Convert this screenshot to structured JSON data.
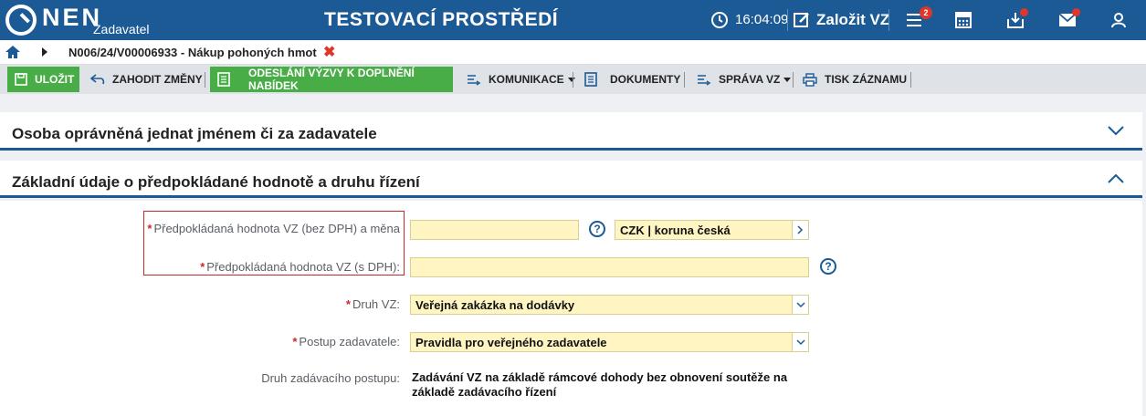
{
  "header": {
    "logo_text": "NEN",
    "logo_sub": "Zadavatel",
    "env_title": "TESTOVACÍ PROSTŘEDÍ",
    "time": "16:04:09",
    "create_label": "Založit VZ",
    "tasks_badge": "2",
    "icons": [
      "clock-icon",
      "edit-icon",
      "tasks-icon",
      "calculator-icon",
      "inbox-icon",
      "mail-icon",
      "user-icon"
    ],
    "brand_color": "#1c5a96"
  },
  "breadcrumb": {
    "text": "N006/24/V00006933 - Nákup pohoných hmot",
    "close": "✖"
  },
  "toolbar": {
    "save": "ULOŽIT",
    "discard": "ZAHODIT ZMĚNY",
    "send": "ODESLÁNÍ VÝZVY K DOPLNĚNÍ NABÍDEK",
    "communication": "KOMUNIKACE",
    "documents": "DOKUMENTY",
    "management": "SPRÁVA VZ",
    "print": "TISK ZÁZNAMU",
    "accent_green": "#49ad47"
  },
  "panels": {
    "authorized_person": "Osoba oprávněná jednat jménem či za zadavatele",
    "basic_info": "Základní údaje o předpokládané hodnotě a druhu řízení"
  },
  "form": {
    "value_excl_vat_label": "Předpokládaná hodnota VZ (bez DPH) a měna",
    "value_excl_vat": "",
    "currency": "CZK | koruna česká",
    "value_incl_vat_label": "Předpokládaná hodnota VZ (s DPH):",
    "value_incl_vat": "",
    "contract_type_label": "Druh VZ:",
    "contract_type": "Veřejná zakázka na dodávky",
    "procedure_label": "Postup zadavatele:",
    "procedure": "Pravidla pro veřejného zadavatele",
    "award_type_label": "Druh zadávacího postupu:",
    "award_type": "Zadávání VZ na základě rámcové dohody bez obnovení soutěže na základě zadávacího řízení",
    "required_mark": "*",
    "help_mark": "?"
  }
}
